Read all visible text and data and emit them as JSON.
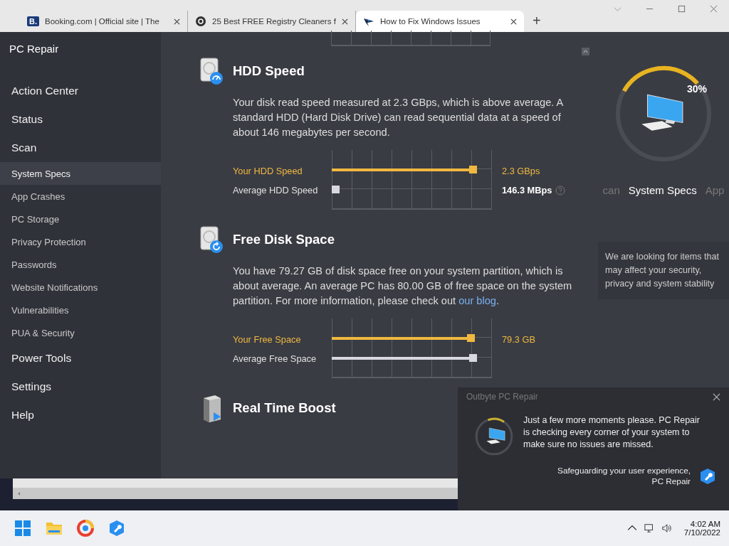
{
  "browser": {
    "tabs": [
      {
        "label": "Booking.com | Official site | The",
        "selected": false,
        "icon_text": "B."
      },
      {
        "label": "25 Best FREE Registry Cleaners f",
        "selected": false
      },
      {
        "label": "How to Fix Windows Issues",
        "selected": true
      }
    ],
    "new_tab": "+"
  },
  "app": {
    "title": "PC Repair",
    "sidebar": {
      "items": [
        {
          "label": "Action Center",
          "kind": "main",
          "selected": false
        },
        {
          "label": "Status",
          "kind": "main",
          "selected": false
        },
        {
          "label": "Scan",
          "kind": "main",
          "selected": false
        },
        {
          "label": "System Specs",
          "kind": "sub",
          "selected": true
        },
        {
          "label": "App Crashes",
          "kind": "sub",
          "selected": false
        },
        {
          "label": "PC Storage",
          "kind": "sub",
          "selected": false
        },
        {
          "label": "Privacy Protection",
          "kind": "sub",
          "selected": false
        },
        {
          "label": "Passwords",
          "kind": "sub",
          "selected": false
        },
        {
          "label": "Website Notifications",
          "kind": "sub",
          "selected": false
        },
        {
          "label": "Vulnerabilities",
          "kind": "sub",
          "selected": false
        },
        {
          "label": "PUA & Security",
          "kind": "sub",
          "selected": false
        },
        {
          "label": "Power Tools",
          "kind": "main",
          "selected": false
        },
        {
          "label": "Settings",
          "kind": "main",
          "selected": false
        },
        {
          "label": "Help",
          "kind": "main",
          "selected": false
        }
      ]
    },
    "sections": [
      {
        "title": "HDD Speed",
        "description": "Your disk read speed measured at 2.3 GBps, which is above average. A standard HDD (Hard Disk Drive) can read sequential data at a speed of about 146 megabytes per second.",
        "rows": [
          {
            "label": "Your HDD Speed",
            "kind": "yours",
            "level": 0.9,
            "value": "2.3 GBps"
          },
          {
            "label": "Average HDD Speed",
            "kind": "average",
            "level": 0.04,
            "value": "146.3 MBps",
            "help": true
          }
        ]
      },
      {
        "title": "Free Disk Space",
        "description": "You have 79.27 GB of disk space free on your system partition, which is about average. An average PC has 80.00 GB of free space on the system partition. For more information, please check out ",
        "link": "our blog",
        "description_end": ".",
        "rows": [
          {
            "label": "Your Free Space",
            "kind": "yours",
            "level": 0.89,
            "value": "79.3 GB"
          },
          {
            "label": "Average Free Space",
            "kind": "average",
            "level": 0.9
          }
        ]
      },
      {
        "title": "Real Time Boost"
      }
    ],
    "progress": {
      "level": 0.3,
      "percent": "30%"
    },
    "steps": [
      {
        "label": "can",
        "selected": false
      },
      {
        "label": "System Specs",
        "selected": true
      },
      {
        "label": "App",
        "selected": false
      }
    ],
    "note": "We are looking for items that may affect your security, privacy and system stability"
  },
  "toast": {
    "app_name": "Outbyte PC Repair",
    "level": 0.15,
    "message": "Just a few more moments please. PC Repair is checking every corner of your system to make sure no issues are missed.",
    "footer": [
      "Safeguarding your user experience,",
      "PC Repair"
    ]
  },
  "taskbar": {
    "time": "4:02 AM",
    "date": "7/10/2022"
  }
}
